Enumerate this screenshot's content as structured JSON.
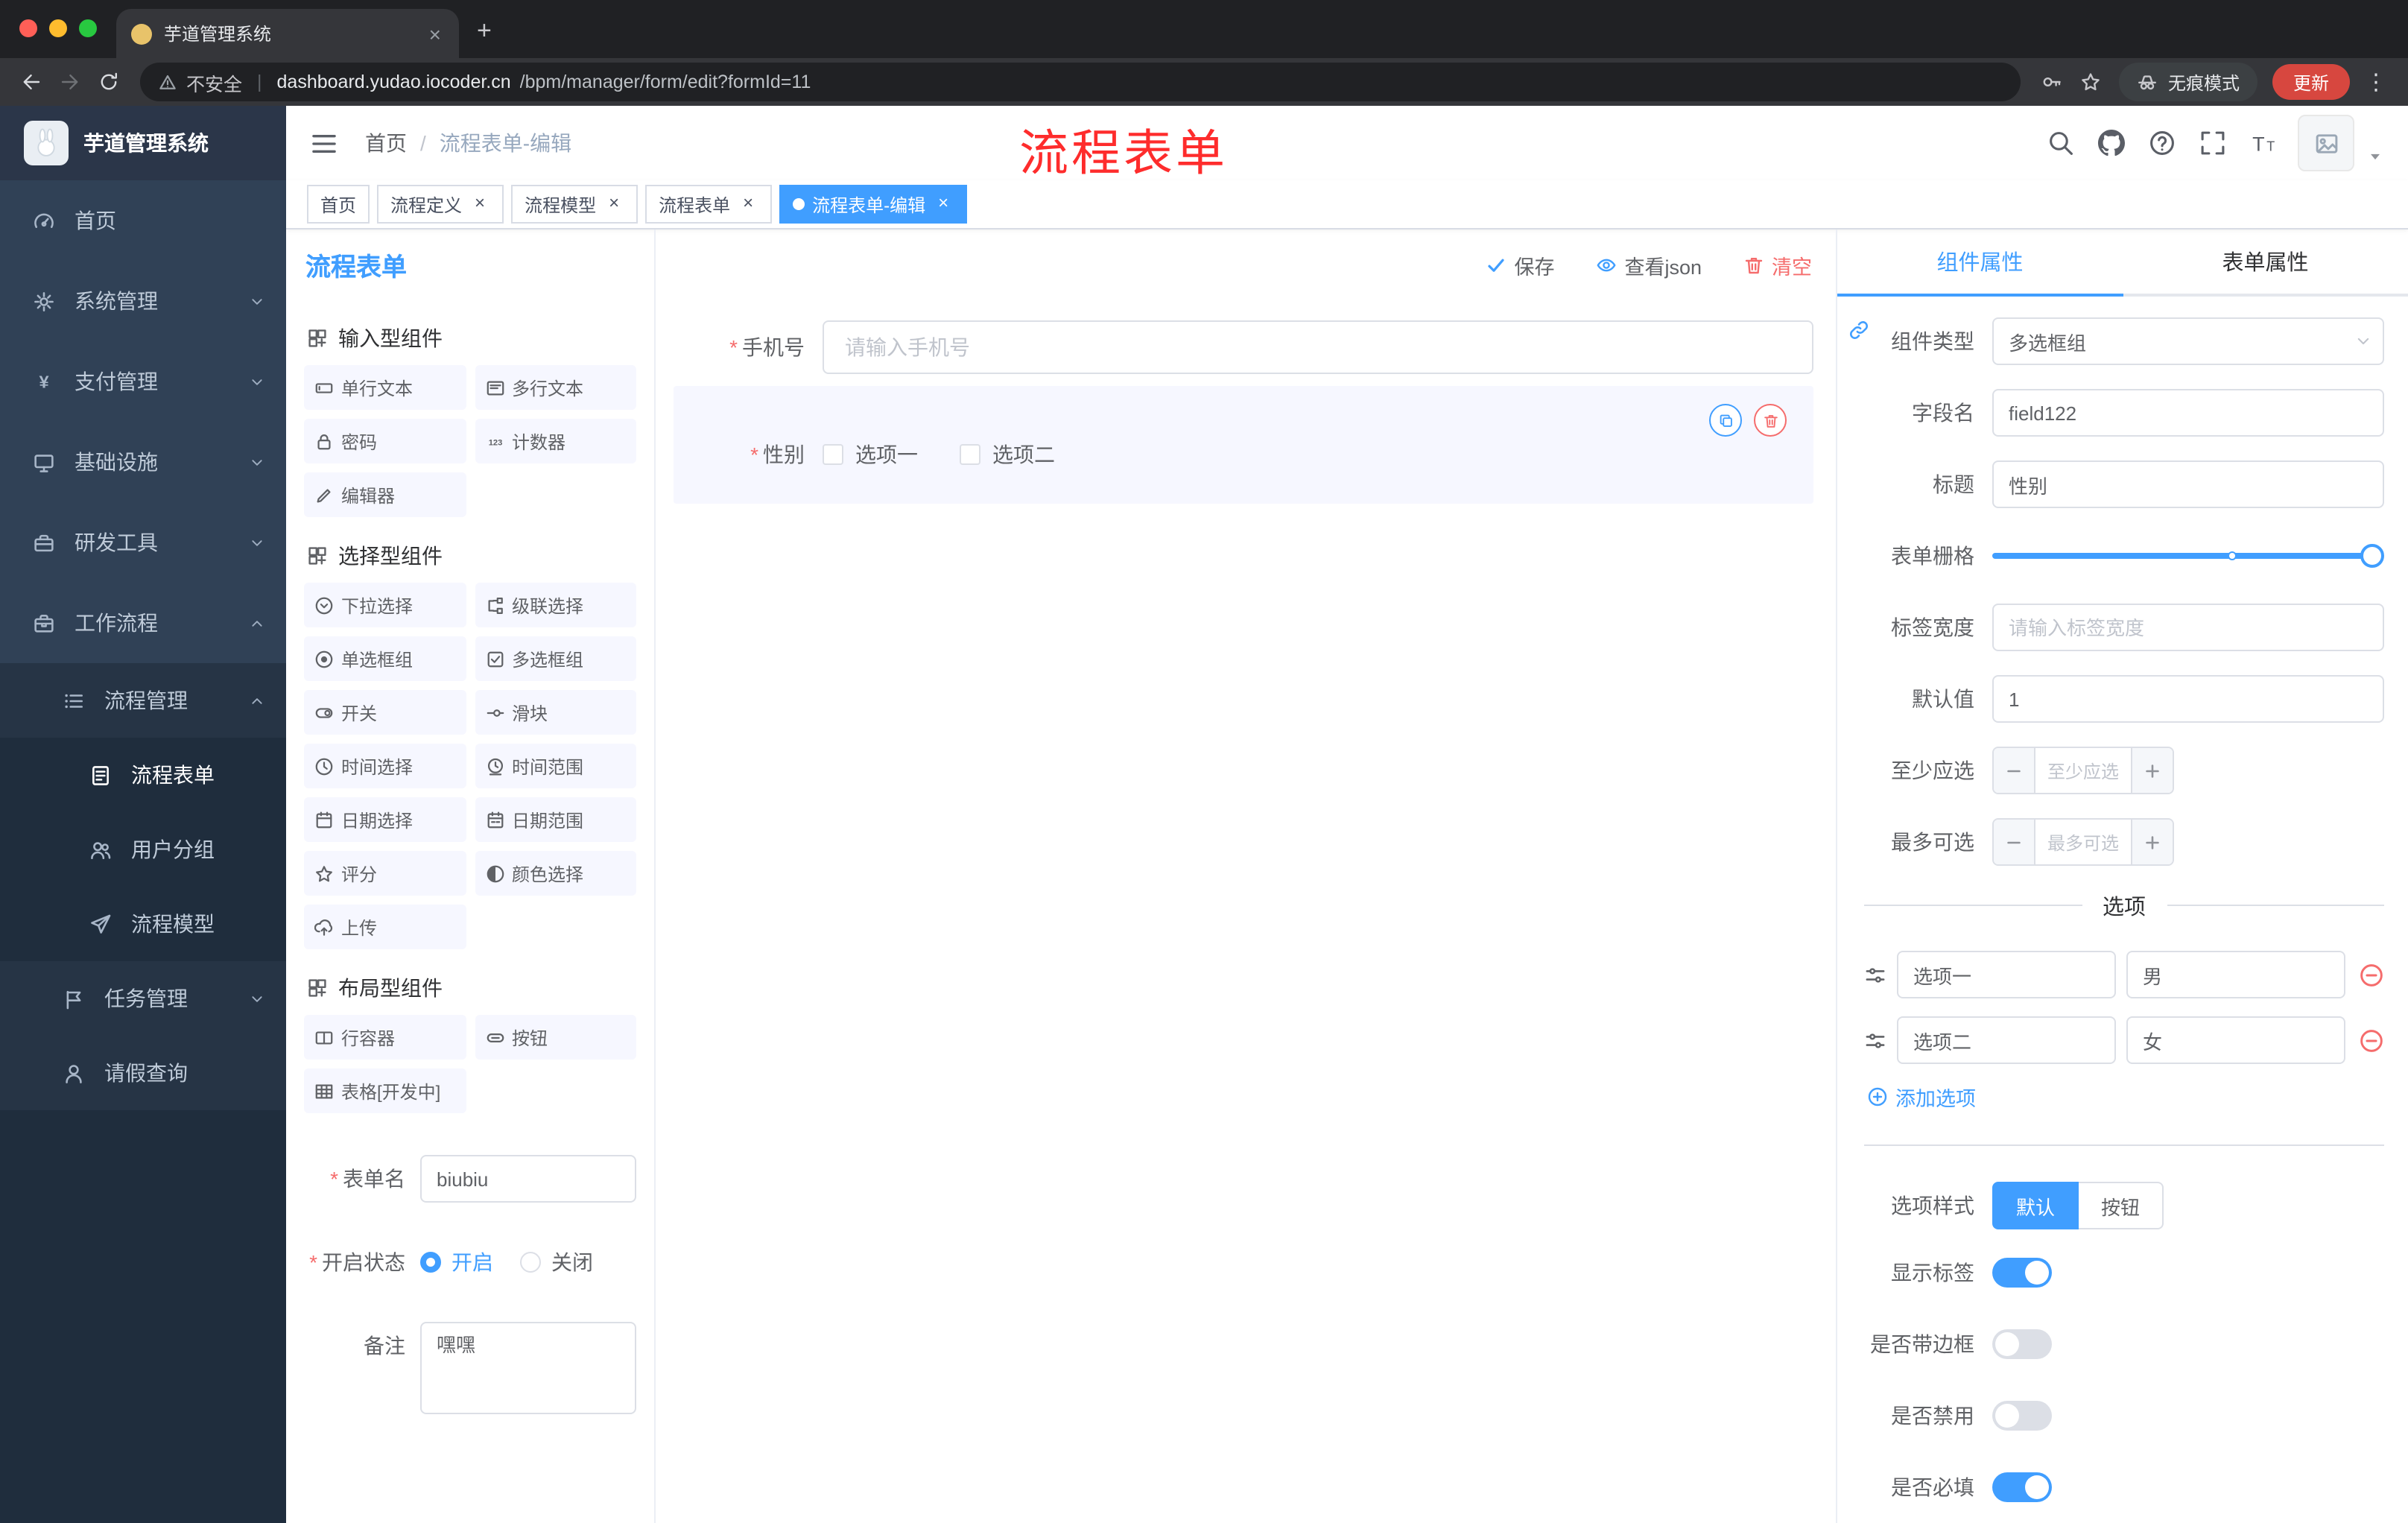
{
  "theme": {
    "accent": "#409eff",
    "danger": "#f56c6c",
    "annotation_red": "#fe2c2c",
    "sidebar_bg": "#304156",
    "update_red": "#d7473f"
  },
  "misc": {
    "required_mark": "*"
  },
  "browser": {
    "tab": {
      "title": "芋道管理系统",
      "close_glyph": "×"
    },
    "new_tab_glyph": "+",
    "address": {
      "security_label": "不安全",
      "separator": "|",
      "host": "dashboard.yudao.iocoder.cn",
      "path": "/bpm/manager/form/edit?formId=11"
    },
    "incognito_label": "无痕模式",
    "update_label": "更新",
    "menu_glyph": "⋮"
  },
  "sidebar": {
    "logo_title": "芋道管理系统",
    "menu": [
      {
        "label": "首页",
        "icon": "dashboard-icon",
        "level": 1
      },
      {
        "label": "系统管理",
        "icon": "gear-icon",
        "level": 1,
        "arrow": "down"
      },
      {
        "label": "支付管理",
        "icon": "yen-icon",
        "level": 1,
        "arrow": "down"
      },
      {
        "label": "基础设施",
        "icon": "monitor-icon",
        "level": 1,
        "arrow": "down"
      },
      {
        "label": "研发工具",
        "icon": "toolbox-icon",
        "level": 1,
        "arrow": "down"
      },
      {
        "label": "工作流程",
        "icon": "briefcase-icon",
        "level": 1,
        "arrow": "up"
      },
      {
        "label": "流程管理",
        "icon": "list-icon",
        "level": 2,
        "arrow": "up"
      },
      {
        "label": "流程表单",
        "icon": "document-icon",
        "level": 3,
        "active": true
      },
      {
        "label": "用户分组",
        "icon": "users-icon",
        "level": 3
      },
      {
        "label": "流程模型",
        "icon": "send-icon",
        "level": 3
      },
      {
        "label": "任务管理",
        "icon": "flag-icon",
        "level": 2,
        "arrow": "down"
      },
      {
        "label": "请假查询",
        "icon": "user-icon",
        "level": 2
      }
    ]
  },
  "navbar": {
    "breadcrumb_home": "首页",
    "breadcrumb_sep": "/",
    "breadcrumb_current": "流程表单-编辑",
    "annotation": "流程表单"
  },
  "tags": [
    {
      "label": "首页",
      "closable": false,
      "active": false
    },
    {
      "label": "流程定义",
      "closable": true,
      "active": false
    },
    {
      "label": "流程模型",
      "closable": true,
      "active": false
    },
    {
      "label": "流程表单",
      "closable": true,
      "active": false
    },
    {
      "label": "流程表单-编辑",
      "closable": true,
      "active": true
    }
  ],
  "palette": {
    "panel_title": "流程表单",
    "groups": [
      {
        "title": "输入型组件",
        "items": [
          {
            "label": "单行文本",
            "icon": "input-icon"
          },
          {
            "label": "多行文本",
            "icon": "textarea-icon"
          },
          {
            "label": "密码",
            "icon": "lock-icon"
          },
          {
            "label": "计数器",
            "icon": "counter-icon"
          },
          {
            "label": "编辑器",
            "icon": "editor-icon"
          }
        ]
      },
      {
        "title": "选择型组件",
        "items": [
          {
            "label": "下拉选择",
            "icon": "select-icon"
          },
          {
            "label": "级联选择",
            "icon": "cascader-icon"
          },
          {
            "label": "单选框组",
            "icon": "radio-icon"
          },
          {
            "label": "多选框组",
            "icon": "checkbox-icon"
          },
          {
            "label": "开关",
            "icon": "switch-icon"
          },
          {
            "label": "滑块",
            "icon": "slider-icon"
          },
          {
            "label": "时间选择",
            "icon": "time-icon"
          },
          {
            "label": "时间范围",
            "icon": "time-range-icon"
          },
          {
            "label": "日期选择",
            "icon": "date-icon"
          },
          {
            "label": "日期范围",
            "icon": "date-range-icon"
          },
          {
            "label": "评分",
            "icon": "rate-icon"
          },
          {
            "label": "颜色选择",
            "icon": "color-icon"
          },
          {
            "label": "上传",
            "icon": "upload-icon"
          }
        ]
      },
      {
        "title": "布局型组件",
        "items": [
          {
            "label": "行容器",
            "icon": "row-icon"
          },
          {
            "label": "按钮",
            "icon": "button-icon"
          },
          {
            "label": "表格[开发中]",
            "icon": "table-icon"
          }
        ]
      }
    ],
    "meta": {
      "name_label": "表单名",
      "name_value": "biubiu",
      "status_label": "开启状态",
      "status_on": "开启",
      "status_off": "关闭",
      "remark_label": "备注",
      "remark_value": "嘿嘿"
    }
  },
  "canvas": {
    "actions": {
      "save": "保存",
      "view_json": "查看json",
      "clear": "清空"
    },
    "phone_field": {
      "label": "手机号",
      "placeholder": "请输入手机号"
    },
    "gender_field": {
      "label": "性别",
      "option1": "选项一",
      "option2": "选项二"
    }
  },
  "properties": {
    "tab_component": "组件属性",
    "tab_form": "表单属性",
    "component_type_label": "组件类型",
    "component_type_value": "多选框组",
    "field_name_label": "字段名",
    "field_name_value": "field122",
    "title_label": "标题",
    "title_value": "性别",
    "grid_label": "表单栅格",
    "label_width_label": "标签宽度",
    "label_width_placeholder": "请输入标签宽度",
    "default_label": "默认值",
    "default_value": "1",
    "min_label": "至少应选",
    "min_placeholder": "至少应选",
    "max_label": "最多可选",
    "max_placeholder": "最多可选",
    "options_title": "选项",
    "options": [
      {
        "label": "选项一",
        "value": "男"
      },
      {
        "label": "选项二",
        "value": "女"
      }
    ],
    "add_option_label": "添加选项",
    "style_label": "选项样式",
    "style_default": "默认",
    "style_button": "按钮",
    "switches": [
      {
        "label": "显示标签",
        "on": true
      },
      {
        "label": "是否带边框",
        "on": false
      },
      {
        "label": "是否禁用",
        "on": false
      },
      {
        "label": "是否必填",
        "on": true
      }
    ]
  }
}
